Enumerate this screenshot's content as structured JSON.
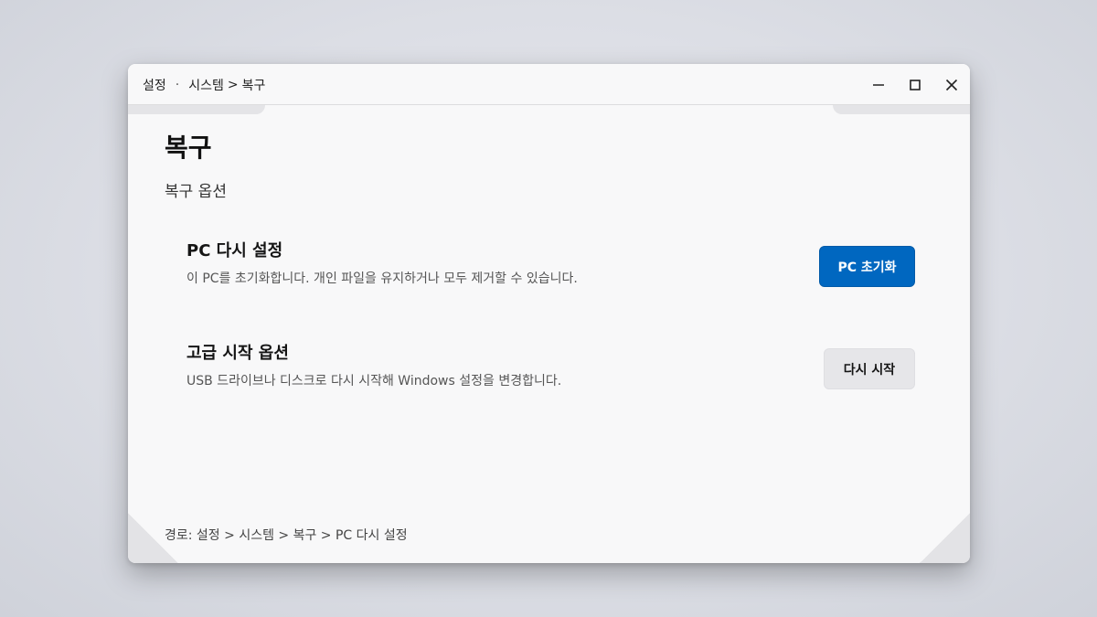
{
  "titlebar": {
    "breadcrumb": {
      "app": "설정",
      "category": "시스템",
      "page": "복구",
      "separator": ">"
    }
  },
  "window_controls": {
    "minimize": "minimize-icon",
    "maximize": "maximize-icon",
    "close": "close-icon"
  },
  "main": {
    "title": "복구",
    "section_title": "복구 옵션",
    "options": [
      {
        "title": "PC 다시 설정",
        "description": "이 PC를 초기화합니다. 개인 파일을 유지하거나 모두 제거할 수 있습니다.",
        "button_label": "PC 초기화"
      },
      {
        "title": "고급 시작 옵션",
        "description": "USB 드라이브나 디스크로 다시 시작해 Windows 설정을 변경합니다.",
        "button_label": "다시 시작"
      }
    ]
  },
  "footer": {
    "path": "경로: 설정 > 시스템 > 복구 > PC 다시 설정"
  },
  "colors": {
    "accent": "#0067c0",
    "secondary_button": "#e6e6e9",
    "window_bg": "#f8f8f9"
  }
}
